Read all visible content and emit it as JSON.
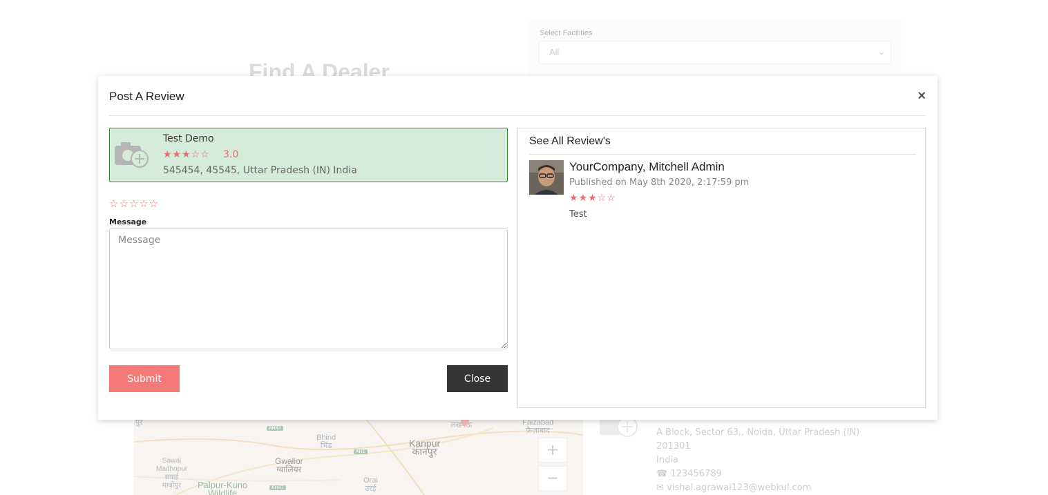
{
  "background": {
    "heading": "Find A Dealer",
    "facilities": {
      "label": "Select Facilities",
      "selected": "All"
    },
    "map": {
      "labels": {
        "jaipur": "पुर",
        "bhind": "Bhind\nभिंड",
        "kanpur": "Kanpur\nकानपुर",
        "lucknow": "लखनऊ",
        "faizabad": "Faizabad\nफ़ैज़ाबाद",
        "sawai": "Sawai\nMadhopur\nसवाई\nमाधोपुर",
        "gwalior": "Gwalior\nग्वालियर",
        "palpur": "Palpur-Kuno\nWildlife",
        "orai": "Orai\nउरई"
      },
      "roads": [
        "AH43",
        "AH1",
        "AH47"
      ],
      "zoom_in": "+",
      "zoom_out": "−"
    },
    "dealer": {
      "address_line1": "A Block, Sector 63,, Noida, Uttar Pradesh (IN)",
      "address_line2": "201301",
      "country": "India",
      "phone": "123456789",
      "email": "vishal.agrawal123@webkul.com"
    }
  },
  "modal": {
    "title": "Post A Review",
    "close_icon": "×",
    "dealer_card": {
      "name": "Test Demo",
      "stars": "★★★☆☆",
      "rating": "3.0",
      "address": "545454, 45545, Uttar Pradesh (IN) India"
    },
    "rating_input": "☆☆☆☆☆",
    "message_label": "Message",
    "message_placeholder": "Message",
    "submit_label": "Submit",
    "close_label": "Close",
    "reviews": {
      "title": "See All Review's",
      "items": [
        {
          "author": "YourCompany, Mitchell Admin",
          "date": "Published on May 8th 2020, 2:17:59 pm",
          "stars": "★★★☆☆",
          "text": "Test"
        }
      ]
    }
  },
  "colors": {
    "accent": "#f47a7a",
    "card_bg": "#d4ecd9",
    "card_border": "#2e8b3a",
    "close_btn": "#353535"
  }
}
